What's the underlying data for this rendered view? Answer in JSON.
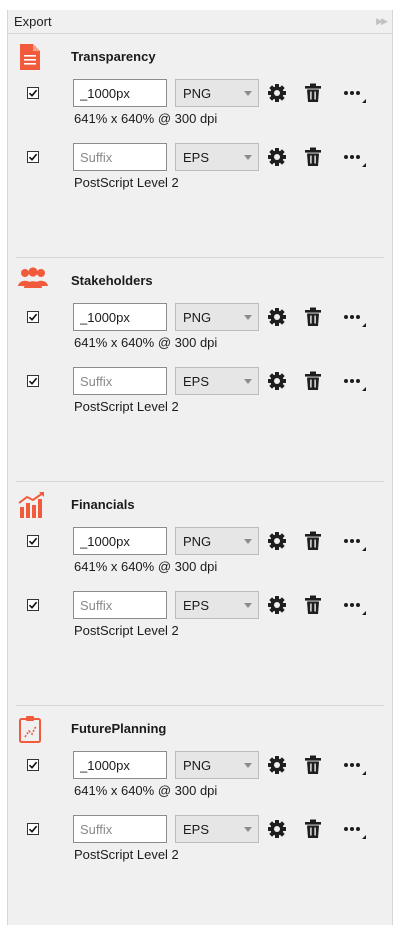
{
  "panel": {
    "title": "Export"
  },
  "sections": [
    {
      "title": "Transparency",
      "icon": "document-icon",
      "rows": [
        {
          "checked": true,
          "suffix_value": "_1000px",
          "suffix_placeholder": "Suffix",
          "format": "PNG",
          "details": "641% x 640% @ 300 dpi"
        },
        {
          "checked": true,
          "suffix_value": "",
          "suffix_placeholder": "Suffix",
          "format": "EPS",
          "details": "PostScript Level 2"
        }
      ]
    },
    {
      "title": "Stakeholders",
      "icon": "people-icon",
      "rows": [
        {
          "checked": true,
          "suffix_value": "_1000px",
          "suffix_placeholder": "Suffix",
          "format": "PNG",
          "details": "641% x 640% @ 300 dpi"
        },
        {
          "checked": true,
          "suffix_value": "",
          "suffix_placeholder": "Suffix",
          "format": "EPS",
          "details": "PostScript Level 2"
        }
      ]
    },
    {
      "title": "Financials",
      "icon": "bar-chart-icon",
      "rows": [
        {
          "checked": true,
          "suffix_value": "_1000px",
          "suffix_placeholder": "Suffix",
          "format": "PNG",
          "details": "641% x 640% @ 300 dpi"
        },
        {
          "checked": true,
          "suffix_value": "",
          "suffix_placeholder": "Suffix",
          "format": "EPS",
          "details": "PostScript Level 2"
        }
      ]
    },
    {
      "title": "FuturePlanning",
      "icon": "clipboard-icon",
      "rows": [
        {
          "checked": true,
          "suffix_value": "_1000px",
          "suffix_placeholder": "Suffix",
          "format": "PNG",
          "details": "641% x 640% @ 300 dpi"
        },
        {
          "checked": true,
          "suffix_value": "",
          "suffix_placeholder": "Suffix",
          "format": "EPS",
          "details": "PostScript Level 2"
        }
      ]
    }
  ],
  "colors": {
    "accent": "#f15a3b",
    "icon_dark": "#1e1e1e"
  }
}
